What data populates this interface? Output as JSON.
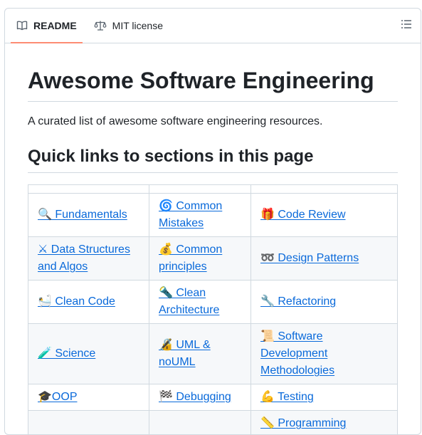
{
  "tabs": [
    {
      "label": "README",
      "icon": "book-icon",
      "active": true
    },
    {
      "label": "MIT license",
      "icon": "scale-icon",
      "active": false
    }
  ],
  "outline_icon": "list-icon",
  "title": "Awesome Software Engineering",
  "description": "A curated list of awesome software engineering resources.",
  "section_heading": "Quick links to sections in this page",
  "table_rows": [
    [
      "🔍 Fundamentals",
      "🌀 Common Mistakes",
      "🎁 Code Review"
    ],
    [
      "⚔ Data Structures and Algos",
      "💰 Common principles",
      "➿ Design Patterns"
    ],
    [
      "🛀 Clean Code",
      "🔦 Clean Architecture",
      "🔧 Refactoring"
    ],
    [
      "🧪 Science",
      "🔏 UML & noUML",
      "📜 Software Development Methodologies"
    ],
    [
      "🎓OOP",
      "🏁 Debugging",
      "💪 Testing"
    ],
    [
      "",
      "",
      "📏 Programming"
    ]
  ],
  "colors": {
    "link": "#0969da",
    "active_tab_underline": "#fd8c73",
    "border": "#d1d9e0"
  }
}
